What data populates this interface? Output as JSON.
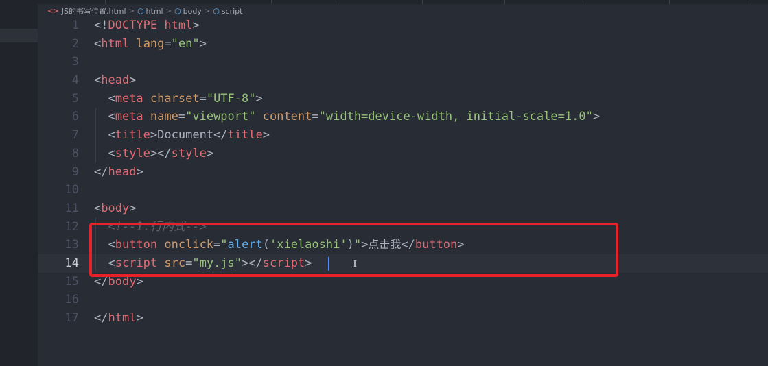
{
  "breadcrumb": {
    "file": "JS的书写位置.html",
    "items": [
      "html",
      "body",
      "script"
    ]
  },
  "editor": {
    "current_line": 14,
    "lines": [
      {
        "n": "1",
        "tokens": [
          [
            "p",
            "<!"
          ],
          [
            "kw",
            "DOCTYPE"
          ],
          [
            "p",
            " "
          ],
          [
            "tag",
            "html"
          ],
          [
            "p",
            ">"
          ]
        ]
      },
      {
        "n": "2",
        "tokens": [
          [
            "p",
            "<"
          ],
          [
            "tag",
            "html"
          ],
          [
            "p",
            " "
          ],
          [
            "attr",
            "lang"
          ],
          [
            "p",
            "="
          ],
          [
            "str",
            "\"en\""
          ],
          [
            "p",
            ">"
          ]
        ]
      },
      {
        "n": "3",
        "tokens": []
      },
      {
        "n": "4",
        "tokens": [
          [
            "p",
            "<"
          ],
          [
            "tag",
            "head"
          ],
          [
            "p",
            ">"
          ]
        ]
      },
      {
        "n": "5",
        "tokens": [
          [
            "p",
            "  <"
          ],
          [
            "tag",
            "meta"
          ],
          [
            "p",
            " "
          ],
          [
            "attr",
            "charset"
          ],
          [
            "p",
            "="
          ],
          [
            "str",
            "\"UTF-8\""
          ],
          [
            "p",
            ">"
          ]
        ]
      },
      {
        "n": "6",
        "tokens": [
          [
            "p",
            "  <"
          ],
          [
            "tag",
            "meta"
          ],
          [
            "p",
            " "
          ],
          [
            "attr",
            "name"
          ],
          [
            "p",
            "="
          ],
          [
            "str",
            "\"viewport\""
          ],
          [
            "p",
            " "
          ],
          [
            "attr",
            "content"
          ],
          [
            "p",
            "="
          ],
          [
            "str",
            "\"width=device-width, initial-scale=1.0\""
          ],
          [
            "p",
            ">"
          ]
        ]
      },
      {
        "n": "7",
        "tokens": [
          [
            "p",
            "  <"
          ],
          [
            "tag",
            "title"
          ],
          [
            "p",
            ">"
          ],
          [
            "txt",
            "Document"
          ],
          [
            "p",
            "</"
          ],
          [
            "tag",
            "title"
          ],
          [
            "p",
            ">"
          ]
        ]
      },
      {
        "n": "8",
        "tokens": [
          [
            "p",
            "  <"
          ],
          [
            "tag",
            "style"
          ],
          [
            "p",
            "></"
          ],
          [
            "tag",
            "style"
          ],
          [
            "p",
            ">"
          ]
        ]
      },
      {
        "n": "9",
        "tokens": [
          [
            "p",
            "</"
          ],
          [
            "tag",
            "head"
          ],
          [
            "p",
            ">"
          ]
        ]
      },
      {
        "n": "10",
        "tokens": []
      },
      {
        "n": "11",
        "tokens": [
          [
            "p",
            "<"
          ],
          [
            "tag",
            "body"
          ],
          [
            "p",
            ">"
          ]
        ]
      },
      {
        "n": "12",
        "tokens": [
          [
            "com",
            "  <!--1.行内式-->"
          ]
        ]
      },
      {
        "n": "13",
        "tokens": [
          [
            "p",
            "  <"
          ],
          [
            "tag",
            "button"
          ],
          [
            "p",
            " "
          ],
          [
            "attr",
            "onclick"
          ],
          [
            "p",
            "="
          ],
          [
            "str",
            "\""
          ],
          [
            "fn",
            "alert"
          ],
          [
            "p",
            "("
          ],
          [
            "str",
            "'xielaoshi'"
          ],
          [
            "p",
            ")"
          ],
          [
            "str",
            "\""
          ],
          [
            "p",
            ">"
          ],
          [
            "cjk",
            "点击我"
          ],
          [
            "p",
            "</"
          ],
          [
            "tag",
            "button"
          ],
          [
            "p",
            ">"
          ]
        ]
      },
      {
        "n": "14",
        "tokens": [
          [
            "p",
            "  <"
          ],
          [
            "tag",
            "script"
          ],
          [
            "p",
            " "
          ],
          [
            "attr",
            "src"
          ],
          [
            "p",
            "="
          ],
          [
            "str",
            "\""
          ],
          [
            "sq",
            "my.js"
          ],
          [
            "str",
            "\""
          ],
          [
            "p",
            "></"
          ],
          [
            "tag",
            "script"
          ],
          [
            "p",
            ">"
          ]
        ]
      },
      {
        "n": "15",
        "tokens": [
          [
            "p",
            "</"
          ],
          [
            "tag",
            "body"
          ],
          [
            "p",
            ">"
          ]
        ]
      },
      {
        "n": "16",
        "tokens": []
      },
      {
        "n": "17",
        "tokens": [
          [
            "p",
            "</"
          ],
          [
            "tag",
            "html"
          ],
          [
            "p",
            ">"
          ]
        ]
      }
    ]
  },
  "colors": {
    "background": "#282c34",
    "highlight_box": "#e8222a",
    "tag": "#e06c75",
    "attribute": "#d19a66",
    "string": "#98c379"
  }
}
